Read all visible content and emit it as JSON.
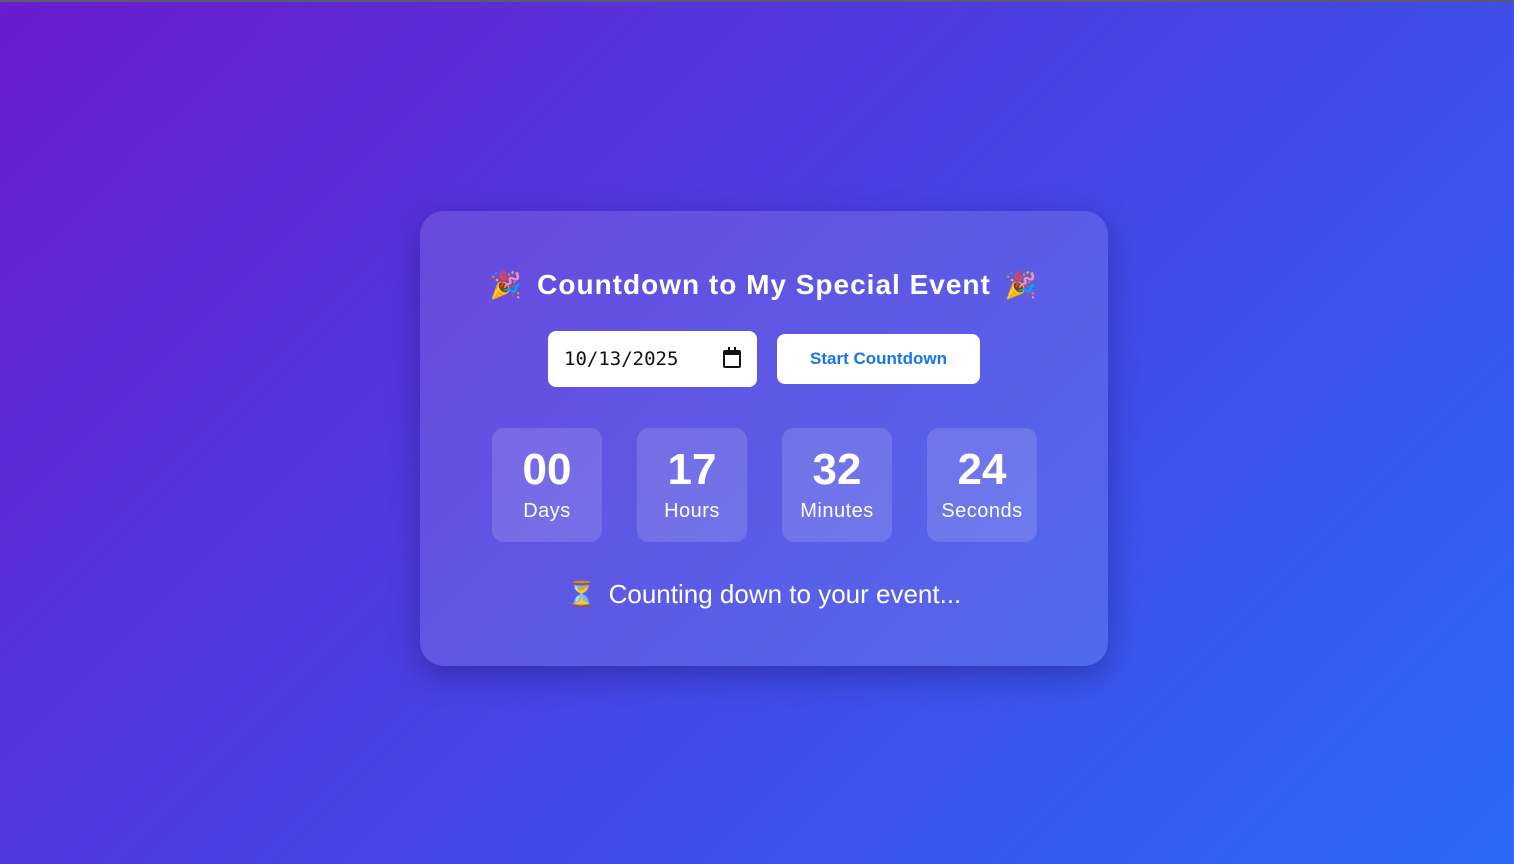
{
  "header": {
    "title": "Countdown to My Special Event",
    "left_icon": "party-popper-icon",
    "right_icon": "party-popper-icon"
  },
  "controls": {
    "date_value": "10/13/2025",
    "start_label": "Start Countdown"
  },
  "countdown": [
    {
      "value": "00",
      "label": "Days"
    },
    {
      "value": "17",
      "label": "Hours"
    },
    {
      "value": "32",
      "label": "Minutes"
    },
    {
      "value": "24",
      "label": "Seconds"
    }
  ],
  "status": {
    "icon": "hourglass-icon",
    "text": "Counting down to your event..."
  },
  "colors": {
    "background_start": "#6a1bce",
    "background_end": "#2a6af5",
    "button_text": "#1677e6"
  }
}
